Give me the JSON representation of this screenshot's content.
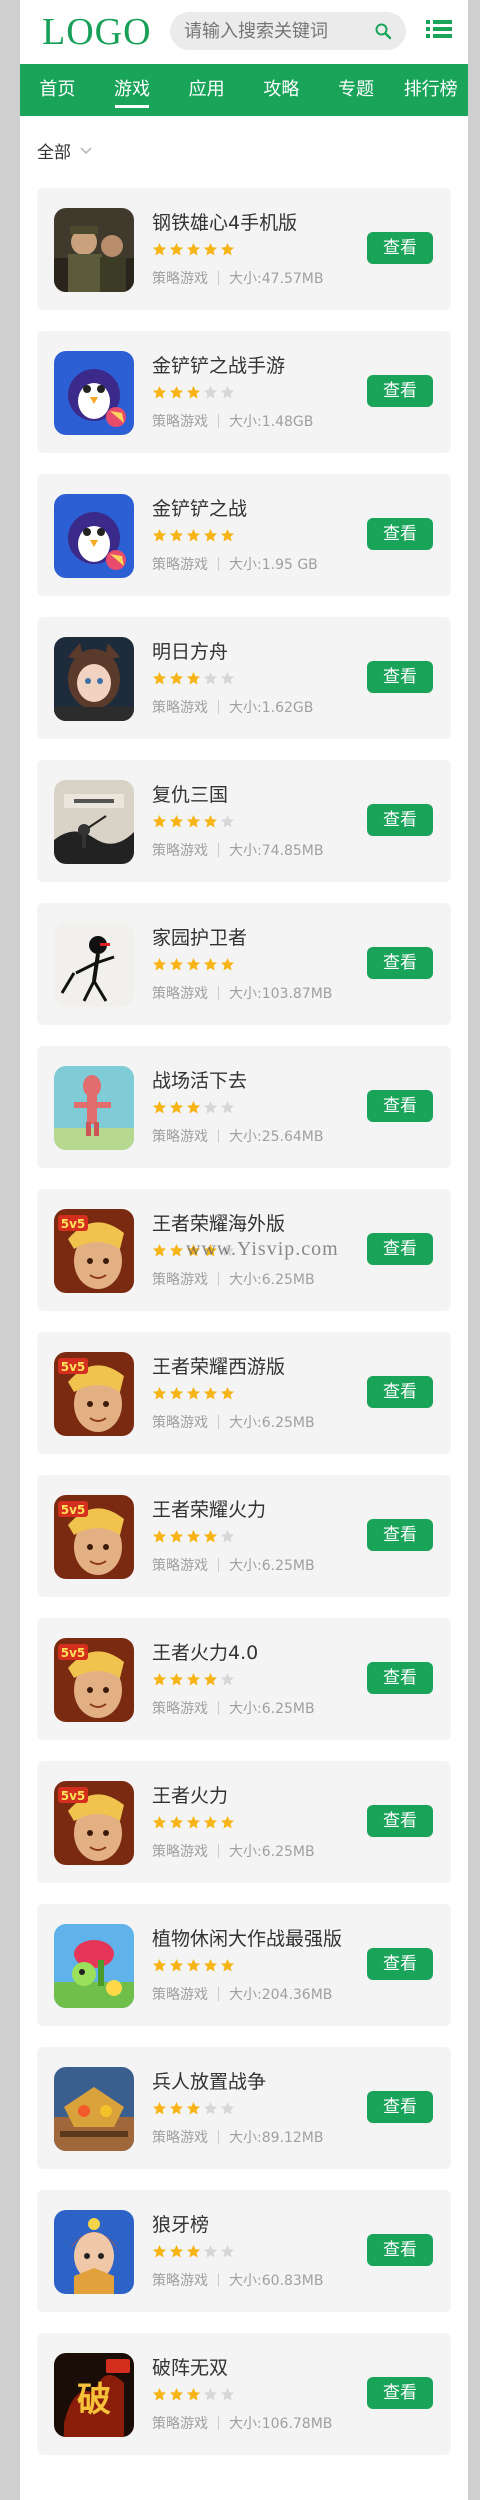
{
  "header": {
    "logo": "LOGO",
    "search_placeholder": "请输入搜索关键词"
  },
  "nav": {
    "items": [
      "首页",
      "游戏",
      "应用",
      "攻略",
      "专题",
      "排行榜"
    ],
    "active_index": 1
  },
  "filter": {
    "label": "全部"
  },
  "watermark": "www.Yisvip.com",
  "colors": {
    "brand": "#19a45a",
    "star_on": "#f6b417",
    "star_off": "#d7d7d7"
  },
  "games": [
    {
      "name": "钢铁雄心4手机版",
      "rating": 5,
      "category": "策略游戏",
      "size": "大小:47.57MB",
      "button": "查看",
      "icon": "war-soldiers-icon"
    },
    {
      "name": "金铲铲之战手游",
      "rating": 3,
      "category": "策略游戏",
      "size": "大小:1.48GB",
      "button": "查看",
      "icon": "penguin-icon"
    },
    {
      "name": "金铲铲之战",
      "rating": 5,
      "category": "策略游戏",
      "size": "大小:1.95 GB",
      "button": "查看",
      "icon": "penguin-icon"
    },
    {
      "name": "明日方舟",
      "rating": 3,
      "category": "策略游戏",
      "size": "大小:1.62GB",
      "button": "查看",
      "icon": "anime-girl-icon"
    },
    {
      "name": "复仇三国",
      "rating": 4,
      "category": "策略游戏",
      "size": "大小:74.85MB",
      "button": "查看",
      "icon": "ink-battle-icon"
    },
    {
      "name": "家园护卫者",
      "rating": 5,
      "category": "策略游戏",
      "size": "大小:103.87MB",
      "button": "查看",
      "icon": "stickman-icon"
    },
    {
      "name": "战场活下去",
      "rating": 3,
      "category": "策略游戏",
      "size": "大小:25.64MB",
      "button": "查看",
      "icon": "ragdoll-icon"
    },
    {
      "name": "王者荣耀海外版",
      "rating": 4,
      "category": "策略游戏",
      "size": "大小:6.25MB",
      "button": "查看",
      "icon": "hero-5v5-icon"
    },
    {
      "name": "王者荣耀西游版",
      "rating": 5,
      "category": "策略游戏",
      "size": "大小:6.25MB",
      "button": "查看",
      "icon": "hero-5v5-icon"
    },
    {
      "name": "王者荣耀火力",
      "rating": 4,
      "category": "策略游戏",
      "size": "大小:6.25MB",
      "button": "查看",
      "icon": "hero-5v5-icon"
    },
    {
      "name": "王者火力4.0",
      "rating": 4,
      "category": "策略游戏",
      "size": "大小:6.25MB",
      "button": "查看",
      "icon": "hero-5v5-icon"
    },
    {
      "name": "王者火力",
      "rating": 5,
      "category": "策略游戏",
      "size": "大小:6.25MB",
      "button": "查看",
      "icon": "hero-5v5-icon"
    },
    {
      "name": "植物休闲大作战最强版",
      "rating": 5,
      "category": "策略游戏",
      "size": "大小:204.36MB",
      "button": "查看",
      "icon": "plant-icon"
    },
    {
      "name": "兵人放置战争",
      "rating": 3,
      "category": "策略游戏",
      "size": "大小:89.12MB",
      "button": "查看",
      "icon": "robot-battle-icon"
    },
    {
      "name": "狼牙榜",
      "rating": 3,
      "category": "策略游戏",
      "size": "大小:60.83MB",
      "button": "查看",
      "icon": "warrior-girl-icon"
    },
    {
      "name": "破阵无双",
      "rating": 3,
      "category": "策略游戏",
      "size": "大小:106.78MB",
      "button": "查看",
      "icon": "fire-calligraphy-icon"
    }
  ]
}
